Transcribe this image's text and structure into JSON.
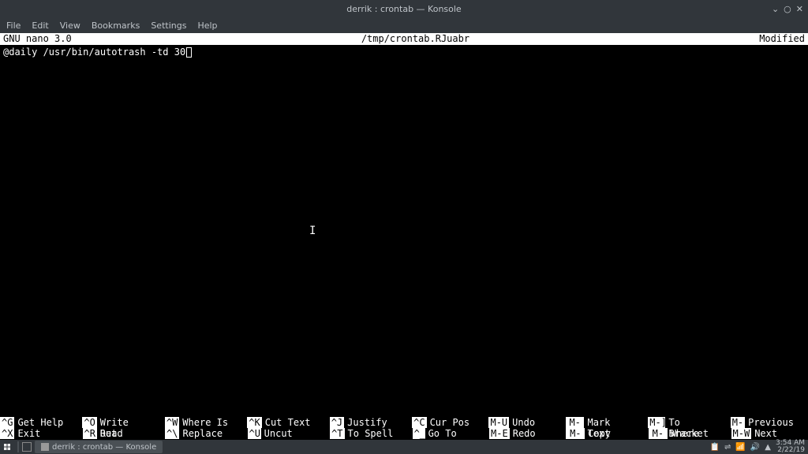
{
  "window": {
    "title": "derrik : crontab — Konsole"
  },
  "menubar": {
    "items": [
      "File",
      "Edit",
      "View",
      "Bookmarks",
      "Settings",
      "Help"
    ]
  },
  "nano": {
    "version": "GNU nano 3.0",
    "filename": "/tmp/crontab.RJuabr",
    "status": "Modified",
    "content": "@daily /usr/bin/autotrash -td 30",
    "shortcuts_row1": [
      {
        "key": "^G",
        "label": "Get Help"
      },
      {
        "key": "^O",
        "label": "Write Out"
      },
      {
        "key": "^W",
        "label": "Where Is"
      },
      {
        "key": "^K",
        "label": "Cut Text"
      },
      {
        "key": "^J",
        "label": "Justify"
      },
      {
        "key": "^C",
        "label": "Cur Pos"
      },
      {
        "key": "M-U",
        "label": "Undo"
      },
      {
        "key": "M-A",
        "label": "Mark Text"
      },
      {
        "key": "M-]",
        "label": "To Bracket"
      },
      {
        "key": "M-Q",
        "label": "Previous"
      }
    ],
    "shortcuts_row2": [
      {
        "key": "^X",
        "label": "Exit"
      },
      {
        "key": "^R",
        "label": "Read File"
      },
      {
        "key": "^\\",
        "label": "Replace"
      },
      {
        "key": "^U",
        "label": "Uncut Text"
      },
      {
        "key": "^T",
        "label": "To Spell"
      },
      {
        "key": "^_",
        "label": "Go To Line"
      },
      {
        "key": "M-E",
        "label": "Redo"
      },
      {
        "key": "M-6",
        "label": "Copy Text"
      },
      {
        "key": "M-Q",
        "label": "Where Was"
      },
      {
        "key": "M-W",
        "label": "Next"
      }
    ]
  },
  "taskbar": {
    "task_label": "derrik : crontab — Konsole",
    "time": "3:54 AM",
    "date": "2/22/19"
  }
}
